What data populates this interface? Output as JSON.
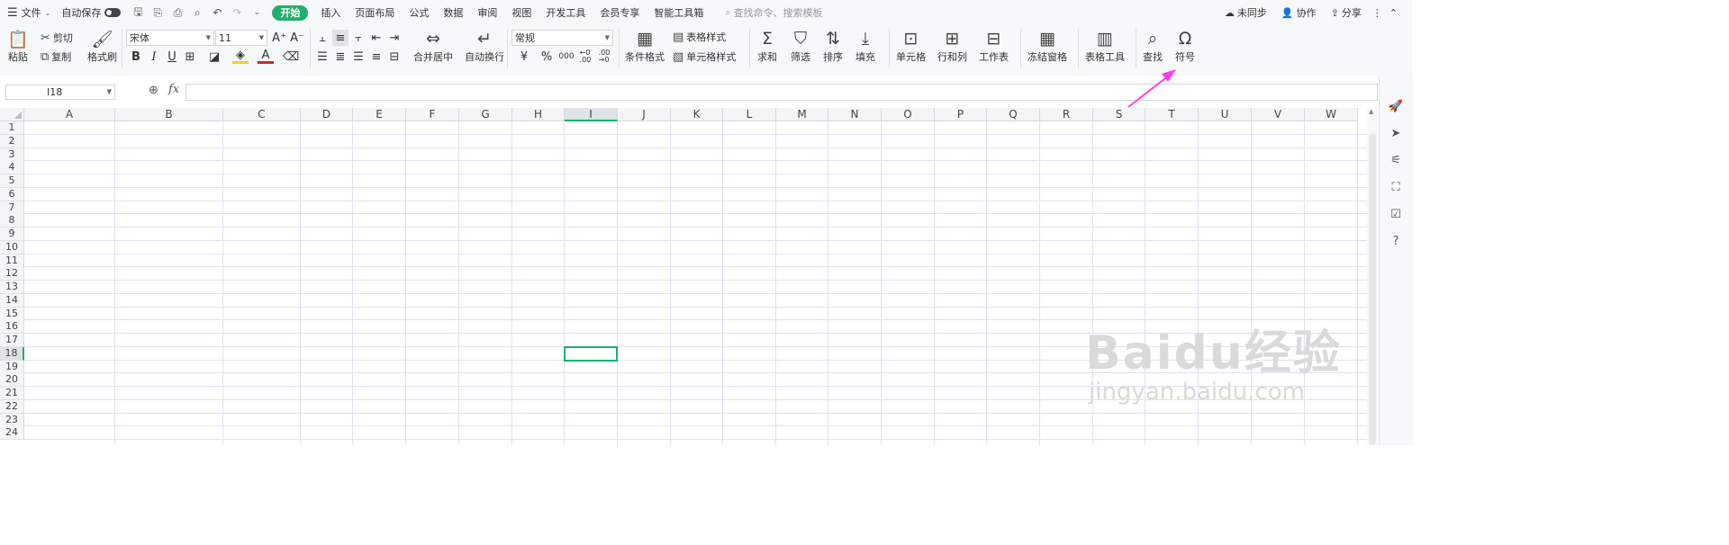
{
  "menu": {
    "file": "文件",
    "autosave": "自动保存",
    "tabs": [
      "开始",
      "插入",
      "页面布局",
      "公式",
      "数据",
      "审阅",
      "视图",
      "开发工具",
      "会员专享",
      "智能工具箱"
    ],
    "search_placeholder": "查找命令、搜索模板",
    "unsynced": "未同步",
    "collab": "协作",
    "share": "分享"
  },
  "ribbon": {
    "paste": "粘贴",
    "cut": "剪切",
    "copy": "复制",
    "format_painter": "格式刷",
    "font_name": "宋体",
    "font_size": "11",
    "merge_center": "合并居中",
    "wrap_text": "自动换行",
    "number_format": "常规",
    "currency_symbol": "¥",
    "percent": "%",
    "thousands": "000",
    "inc_decimal": "←0\n.00",
    "dec_decimal": ".00\n→0",
    "cond_format": "条件格式",
    "table_style": "表格样式",
    "cell_style": "单元格样式",
    "sum": "求和",
    "filter": "筛选",
    "sort": "排序",
    "fill": "填充",
    "cell": "单元格",
    "row_col": "行和列",
    "worksheet": "工作表",
    "freeze": "冻结窗格",
    "table_tools": "表格工具",
    "find": "查找",
    "symbol": "符号"
  },
  "formula_bar": {
    "name_box": "I18",
    "fx": "fx",
    "value": ""
  },
  "sheet": {
    "columns": [
      "A",
      "B",
      "C",
      "D",
      "E",
      "F",
      "G",
      "H",
      "I",
      "J",
      "K",
      "L",
      "M",
      "N",
      "O",
      "P",
      "Q",
      "R",
      "S",
      "T",
      "U",
      "V",
      "W"
    ],
    "rows": [
      "1",
      "2",
      "3",
      "4",
      "5",
      "6",
      "7",
      "8",
      "9",
      "10",
      "11",
      "12",
      "13",
      "14",
      "15",
      "16",
      "17",
      "18",
      "19",
      "20",
      "21",
      "22",
      "23",
      "24"
    ],
    "selected_column": "I",
    "selected_row": "18"
  },
  "watermark": {
    "brand": "Baidu经验",
    "url": "jingyan.baidu.com"
  },
  "colors": {
    "accent": "#1fb16b",
    "annotation_arrow": "#ff3cf0"
  }
}
